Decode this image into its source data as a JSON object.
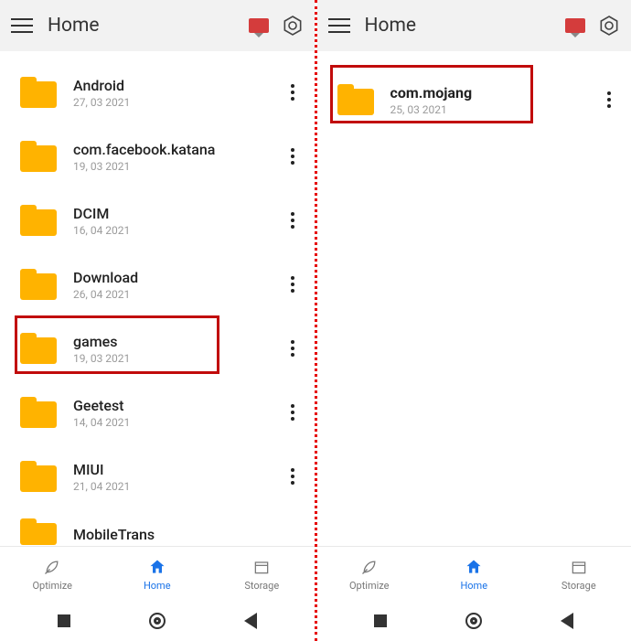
{
  "left": {
    "title": "Home",
    "files": [
      {
        "name": "Android",
        "date": "27, 03 2021",
        "bold": false
      },
      {
        "name": "com.facebook.katana",
        "date": "19, 03 2021",
        "bold": false
      },
      {
        "name": "DCIM",
        "date": "16, 04 2021",
        "bold": false
      },
      {
        "name": "Download",
        "date": "26, 04 2021",
        "bold": false
      },
      {
        "name": "games",
        "date": "19, 03 2021",
        "bold": false,
        "highlighted": true
      },
      {
        "name": "Geetest",
        "date": "14, 04 2021",
        "bold": false
      },
      {
        "name": "MIUI",
        "date": "21, 04 2021",
        "bold": false
      },
      {
        "name": "MobileTrans",
        "date": "",
        "bold": false
      }
    ]
  },
  "right": {
    "title": "Home",
    "files": [
      {
        "name": "com.mojang",
        "date": "25, 03 2021",
        "bold": true,
        "highlighted": true
      }
    ]
  },
  "nav": {
    "optimize": "Optimize",
    "home": "Home",
    "storage": "Storage"
  }
}
